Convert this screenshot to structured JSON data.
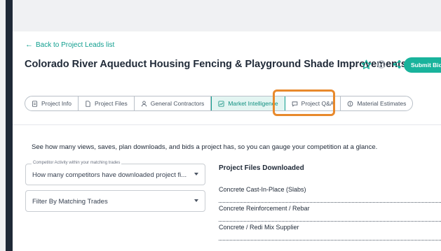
{
  "nav": {
    "back_label": "Back to Project Leads list"
  },
  "project": {
    "title": "Colorado River Aqueduct Housing Fencing & Playground Shade Improvements"
  },
  "actions": {
    "submit_bid_label": "Submit Bid"
  },
  "tabs": [
    {
      "label": "Project Info",
      "icon": "document-icon"
    },
    {
      "label": "Project Files",
      "icon": "file-icon"
    },
    {
      "label": "General Contractors",
      "icon": "person-icon"
    },
    {
      "label": "Market Intelligence",
      "icon": "chart-icon",
      "active": true
    },
    {
      "label": "Project Q&A",
      "icon": "chat-icon"
    },
    {
      "label": "Material Estimates",
      "icon": "estimate-icon"
    }
  ],
  "main": {
    "description": "See how many views, saves, plan downloads, and bids a project has, so you can gauge your competition at a glance.",
    "competitor_select": {
      "label": "Competitor Activity within your matching trades",
      "value": "How many competitors have downloaded project fi..."
    },
    "trade_filter": {
      "placeholder": "Filter By Matching Trades"
    },
    "files_heading": "Project Files Downloaded",
    "files": [
      "Concrete Cast-In-Place (Slabs)",
      "Concrete Reinforcement / Rebar",
      "Concrete / Redi Mix Supplier"
    ]
  },
  "colors": {
    "accent": "#19b39c",
    "highlight": "#e8892c",
    "text": "#1f2937"
  }
}
